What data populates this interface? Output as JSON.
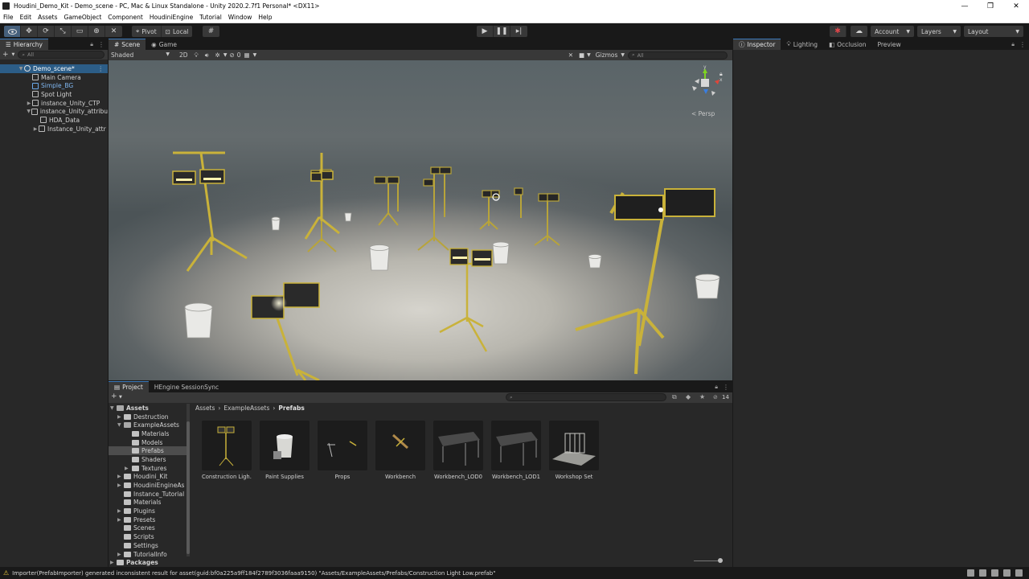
{
  "window": {
    "title": "Houdini_Demo_Kit - Demo_scene - PC, Mac & Linux Standalone - Unity 2020.2.7f1 Personal* <DX11>",
    "controls": [
      "—",
      "❐",
      "✕"
    ]
  },
  "menu": [
    "File",
    "Edit",
    "Assets",
    "GameObject",
    "Component",
    "HoudiniEngine",
    "Tutorial",
    "Window",
    "Help"
  ],
  "toolbar": {
    "pivot_label": "Pivot",
    "local_label": "Local",
    "account_label": "Account",
    "layers_label": "Layers",
    "layout_label": "Layout"
  },
  "hierarchy": {
    "tab_label": "Hierarchy",
    "search_placeholder": "All",
    "items": [
      {
        "label": "Demo_scene*",
        "depth": 0,
        "type": "scene"
      },
      {
        "label": "Main Camera",
        "depth": 1,
        "type": "object"
      },
      {
        "label": "Simple_BG",
        "depth": 1,
        "type": "prefab"
      },
      {
        "label": "Spot Light",
        "depth": 1,
        "type": "object"
      },
      {
        "label": "instance_Unity_CTP",
        "depth": 1,
        "type": "object"
      },
      {
        "label": "instance_Unity_attribu",
        "depth": 1,
        "type": "object"
      },
      {
        "label": "HDA_Data",
        "depth": 2,
        "type": "object"
      },
      {
        "label": "Instance_Unity_attr",
        "depth": 2,
        "type": "object"
      }
    ]
  },
  "scene": {
    "tabs": [
      "Scene",
      "Game"
    ],
    "shading_mode": "Shaded",
    "mode_2d": "2D",
    "hidden_count": "0",
    "gizmos_label": "Gizmos",
    "search_placeholder": "All",
    "persp_label": "< Persp"
  },
  "inspector": {
    "tabs": [
      "Inspector",
      "Lighting",
      "Occlusion",
      "Preview"
    ]
  },
  "project": {
    "tabs": [
      "Project",
      "HEngine SessionSync"
    ],
    "breadcrumb": [
      "Assets",
      "ExampleAssets",
      "Prefabs"
    ],
    "count_badge": "14",
    "folders": [
      {
        "label": "Assets",
        "depth": 0,
        "bold": true
      },
      {
        "label": "Destruction",
        "depth": 1
      },
      {
        "label": "ExampleAssets",
        "depth": 1
      },
      {
        "label": "Materials",
        "depth": 2
      },
      {
        "label": "Models",
        "depth": 2
      },
      {
        "label": "Prefabs",
        "depth": 2,
        "selected": true
      },
      {
        "label": "Shaders",
        "depth": 2
      },
      {
        "label": "Textures",
        "depth": 2
      },
      {
        "label": "Houdini_Kit",
        "depth": 1
      },
      {
        "label": "HoudiniEngineAs",
        "depth": 1
      },
      {
        "label": "Instance_Tutorial",
        "depth": 1
      },
      {
        "label": "Materials",
        "depth": 1
      },
      {
        "label": "Plugins",
        "depth": 1
      },
      {
        "label": "Presets",
        "depth": 1
      },
      {
        "label": "Scenes",
        "depth": 1
      },
      {
        "label": "Scripts",
        "depth": 1
      },
      {
        "label": "Settings",
        "depth": 1
      },
      {
        "label": "TutorialInfo",
        "depth": 1
      },
      {
        "label": "Packages",
        "depth": 0,
        "bold": true
      }
    ],
    "assets": [
      {
        "label": "Construction Ligh...",
        "icon": "construction-light-thumbnail"
      },
      {
        "label": "Paint Supplies",
        "icon": "paint-bucket-thumbnail"
      },
      {
        "label": "Props",
        "icon": "props-thumbnail"
      },
      {
        "label": "Workbench",
        "icon": "workbench-thumbnail"
      },
      {
        "label": "Workbench_LOD0",
        "icon": "workbench-lod0-thumbnail"
      },
      {
        "label": "Workbench_LOD1",
        "icon": "workbench-lod1-thumbnail"
      },
      {
        "label": "Workshop Set",
        "icon": "workshop-set-thumbnail"
      }
    ]
  },
  "status": {
    "message": "Importer(PrefabImporter) generated inconsistent result for asset(guid:bf0a225a9ff184f2789f3036faaa9150) \"Assets/ExampleAssets/Prefabs/Construction Light Low.prefab\""
  },
  "colors": {
    "accent": "#3a79bb",
    "selection": "#2c5d87",
    "light_yellow": "#c9b23a",
    "warning": "#e6c63a"
  }
}
